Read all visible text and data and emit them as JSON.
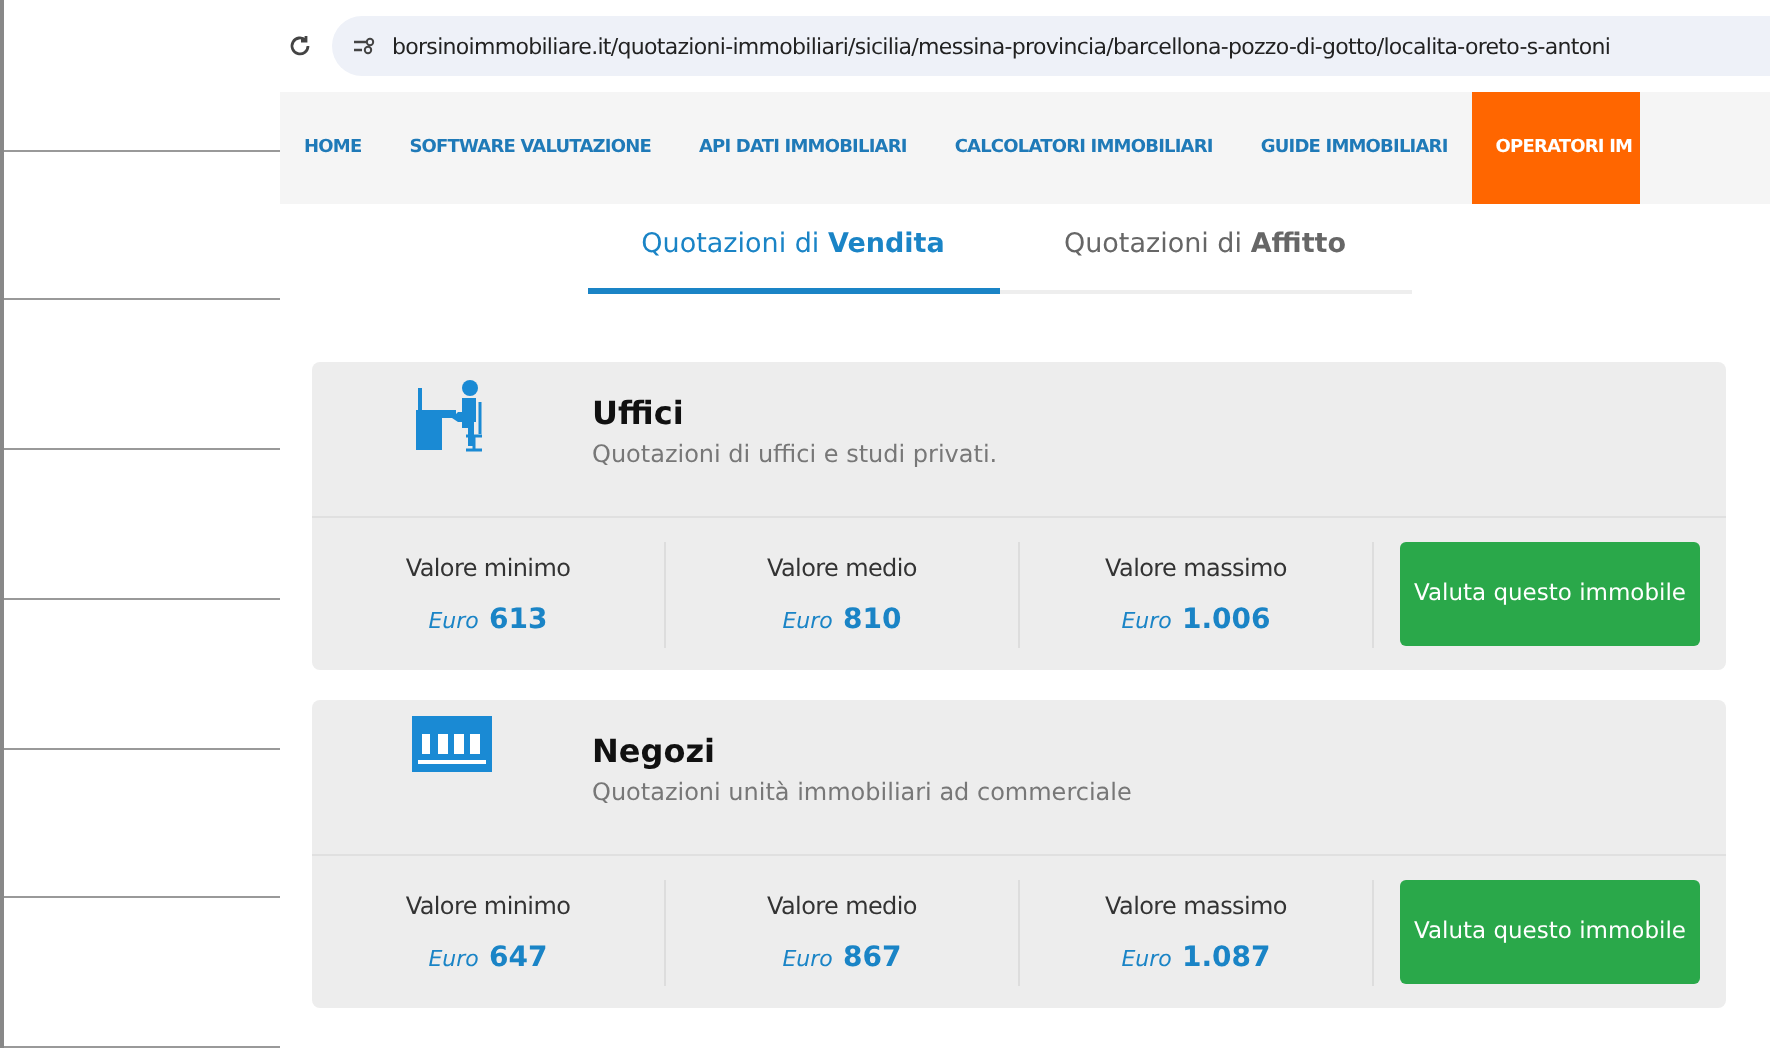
{
  "address_bar": {
    "url": "borsinoimmobiliare.it/quotazioni-immobiliari/sicilia/messina-provincia/barcellona-pozzo-di-gotto/localita-oreto-s-antoni"
  },
  "nav": [
    {
      "label": "HOME",
      "highlighted": false
    },
    {
      "label": "SOFTWARE VALUTAZIONE",
      "highlighted": false
    },
    {
      "label": "API DATI IMMOBILIARI",
      "highlighted": false
    },
    {
      "label": "CALCOLATORI IMMOBILIARI",
      "highlighted": false
    },
    {
      "label": "GUIDE IMMOBILIARI",
      "highlighted": false
    },
    {
      "label": "OPERATORI IM",
      "highlighted": true
    }
  ],
  "tabs": [
    {
      "label": "Quotazioni di **Vendita**",
      "selected": true
    },
    {
      "label": "Quotazioni di **Affitto**",
      "selected": false
    }
  ],
  "cards": [
    {
      "kind": "office",
      "title": "Uffici",
      "subtitle": "Quotazioni di uffici e studi privati.",
      "values": [
        {
          "label": "Valore minimo",
          "unit": "Euro",
          "amount": "613"
        },
        {
          "label": "Valore medio",
          "unit": "Euro",
          "amount": "810"
        },
        {
          "label": "Valore massimo",
          "unit": "Euro",
          "amount": "1.006"
        }
      ],
      "button": "Valuta questo immobile"
    },
    {
      "kind": "shop",
      "title": "Negozi",
      "subtitle": "Quotazioni unità immobiliari ad commerciale",
      "values": [
        {
          "label": "Valore minimo",
          "unit": "Euro",
          "amount": "647"
        },
        {
          "label": "Valore medio",
          "unit": "Euro",
          "amount": "867"
        },
        {
          "label": "Valore massimo",
          "unit": "Euro",
          "amount": "1.087"
        }
      ],
      "button": "Valuta questo immobile"
    }
  ]
}
